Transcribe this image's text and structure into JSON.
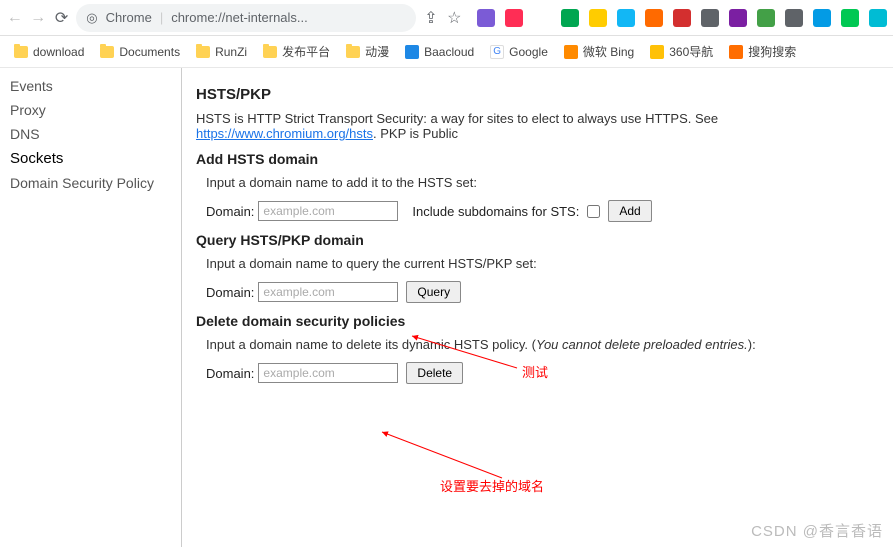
{
  "toolbar": {
    "url_prefix": "Chrome",
    "url": "chrome://net-internals..."
  },
  "ext_colors": [
    "#7b5bd6",
    "#ff2d55",
    "#ffffff",
    "#00a651",
    "#ffcc00",
    "#12b7f5",
    "#ff6a00",
    "#d32f2f",
    "#5f6368",
    "#7b1fa2",
    "#43a047",
    "#5f6368",
    "#039be5",
    "#00c853",
    "#00bcd4"
  ],
  "bookmarks": [
    {
      "type": "folder",
      "label": "download"
    },
    {
      "type": "folder",
      "label": "Documents"
    },
    {
      "type": "folder",
      "label": "RunZi"
    },
    {
      "type": "folder",
      "label": "发布平台"
    },
    {
      "type": "folder",
      "label": "动漫"
    },
    {
      "type": "site",
      "label": "Baacloud",
      "color": "#1e88e5"
    },
    {
      "type": "site",
      "label": "Google",
      "color": "#ffffff",
      "g": true
    },
    {
      "type": "site",
      "label": "微软 Bing",
      "color": "#ff8a00"
    },
    {
      "type": "site",
      "label": "360导航",
      "color": "#ffc107"
    },
    {
      "type": "site",
      "label": "搜狗搜索",
      "color": "#ff6d00"
    }
  ],
  "sidebar": {
    "items": [
      "Events",
      "Proxy",
      "DNS",
      "Sockets",
      "Domain Security Policy"
    ],
    "active": 3
  },
  "page": {
    "title": "HSTS/PKP",
    "intro_a": "HSTS is HTTP Strict Transport Security: a way for sites to elect to always use HTTPS. See ",
    "intro_link": "https://www.chromium.org/hsts",
    "intro_b": ". PKP is Public",
    "add": {
      "heading": "Add HSTS domain",
      "desc": "Input a domain name to add it to the HSTS set:",
      "label": "Domain:",
      "placeholder": "example.com",
      "subs_label": "Include subdomains for STS:",
      "button": "Add"
    },
    "query": {
      "heading": "Query HSTS/PKP domain",
      "desc": "Input a domain name to query the current HSTS/PKP set:",
      "label": "Domain:",
      "placeholder": "example.com",
      "button": "Query"
    },
    "del": {
      "heading": "Delete domain security policies",
      "desc_a": "Input a domain name to delete its dynamic HSTS policy. (",
      "desc_i": "You cannot delete preloaded entries.",
      "desc_b": "):",
      "label": "Domain:",
      "placeholder": "example.com",
      "button": "Delete"
    }
  },
  "annotations": {
    "a1": "测试",
    "a2": "设置要去掉的域名"
  },
  "watermark": "CSDN @香言香语"
}
